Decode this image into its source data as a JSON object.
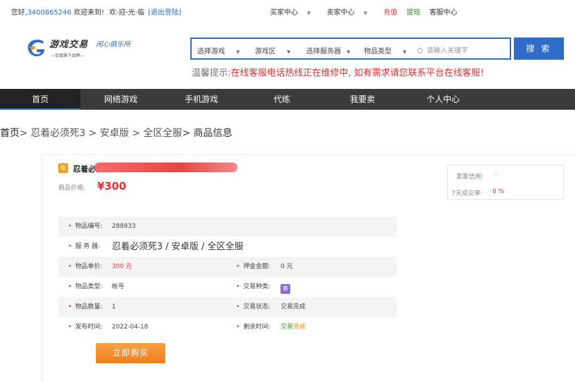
{
  "topbar": {
    "greeting_prefix": "您好,",
    "user_id": "3400865246",
    "greeting_suffix": " 欢迎来到!",
    "welcome": "欢-迎-光-临",
    "logout": "[退出登陆]",
    "buyer_center": "买家中心",
    "seller_center": "卖家中心",
    "recharge": "充值",
    "withdraw": "提现",
    "service_center": "客服中心"
  },
  "logo": {
    "main_text": "游戏交易",
    "script_text": "闲心俱乐所",
    "tagline": "—百度旗下品牌—"
  },
  "search": {
    "select_game": "选择游戏",
    "game_zone": "游戏区",
    "select_server": "选择服务器",
    "item_type": "物品类型",
    "placeholder": "请输入关键字",
    "button": "搜 索"
  },
  "notice": {
    "label": "温馨提示:",
    "message": "在线客服电话热线正在维修中, 如有需求请您联系平台在线客服!"
  },
  "nav": {
    "items": [
      "首页",
      "网络游戏",
      "手机游戏",
      "代练",
      "我要卖",
      "个人中心"
    ]
  },
  "breadcrumb": {
    "home": "首页",
    "p1": "> 忍着必须死3 > 安卓版 > 全区全服",
    "current": "> 商品信息"
  },
  "product": {
    "badge": "账",
    "title": "忍着必须死3",
    "price_label": "商品价格:",
    "price": "¥300"
  },
  "seller": {
    "credit_label": "卖家信用:",
    "rate_label": "7天成交率:",
    "rate_value": "0 %"
  },
  "details": {
    "id_label": "物品编号:",
    "id_value": "288933",
    "server_label": "服 务 器:",
    "server_value": "忍着必须死3 / 安卓版 / 全区全服",
    "unit_price_label": "物品单价:",
    "unit_price_value": "300 元",
    "deposit_label": "押金金额:",
    "deposit_value": "0 元",
    "type_label": "物品类型:",
    "type_value": "帐号",
    "trade_type_label": "交易种类:",
    "trade_type_icon": "寄",
    "qty_label": "物品数量:",
    "qty_value": "1",
    "status_label": "交易状态:",
    "status_value": "交易完成",
    "date_label": "发布时间:",
    "date_value": "2022-04-18",
    "remaining_label": "剩余时间:",
    "remaining_a": "交易",
    "remaining_b": "完成"
  },
  "buy_button": "立即购买",
  "colors": {
    "accent_blue": "#2f6dc8",
    "price_red": "#e03030",
    "nav_dark": "#3b3b3b",
    "buy_orange": "#ee7f1c"
  }
}
